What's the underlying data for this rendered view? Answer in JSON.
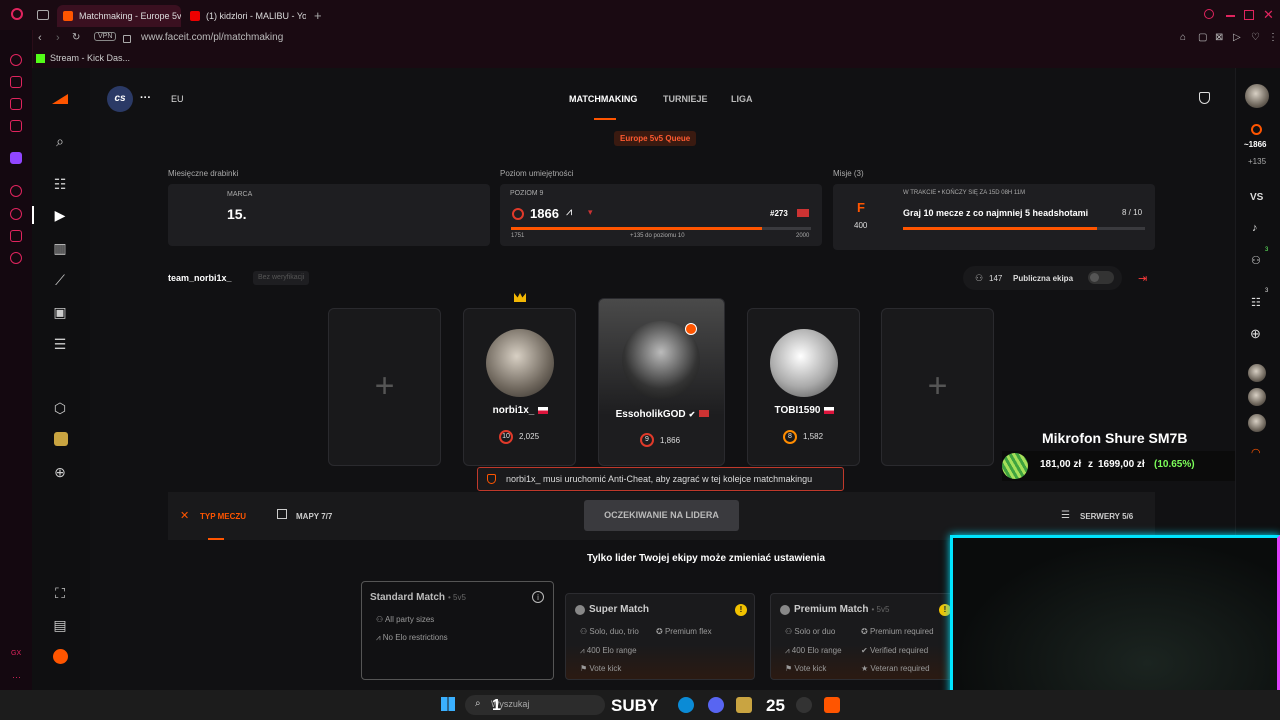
{
  "browser": {
    "tabs": [
      {
        "title": "Matchmaking - Europe 5v5"
      },
      {
        "title": "(1) kidzlori - MALIBU - You"
      }
    ],
    "vpn_badge": "VPN",
    "url": "www.faceit.com/pl/matchmaking",
    "bookmark": "Stream - Kick Das..."
  },
  "header": {
    "game_badge": "cs",
    "region": "EU",
    "nav": [
      "MATCHMAKING",
      "TURNIEJE",
      "LIGA"
    ],
    "active_nav": "MATCHMAKING",
    "queue_badge": "Europe 5v5 Queue"
  },
  "stats": {
    "monthly": {
      "label": "Miesięczne drabinki",
      "month": "MARCA",
      "value": "15."
    },
    "skill": {
      "label": "Poziom umiejętności",
      "level_label": "POZIOM 9",
      "elo": "1866",
      "rank": "#273",
      "progress": 0.836,
      "min": "1751",
      "to_next": "+135 do poziomu 10",
      "max": "2000"
    },
    "missions": {
      "label": "Misje (3)",
      "status": "W TRAKCIE • KOŃCZY SIĘ ZA 15D 08H 11M",
      "grade": "F",
      "points": "400",
      "task": "Graj 10 mecze z co najmniej 5 headshotami",
      "count": "8 / 10",
      "progress": 0.8
    }
  },
  "team": {
    "name": "team_norbi1x_",
    "verify_badge": "Bez weryfikacji",
    "followers": "147",
    "public_label": "Publiczna ekipa"
  },
  "players": [
    {
      "name": "norbi1x_",
      "level": "10",
      "elo": "2,025"
    },
    {
      "name": "EssoholikGOD",
      "level": "9",
      "elo": "1,866"
    },
    {
      "name": "TOBI1590",
      "level": "8",
      "elo": "1,582"
    }
  ],
  "warning": "norbi1x_ musi uruchomić Anti-Cheat, aby zagrać w tej kolejce matchmakingu",
  "match_bar": {
    "type_tab": "TYP MECZU",
    "maps_tab": "MAPY 7/7",
    "waiting_button": "OCZEKIWANIE NA LIDERA",
    "servers_tab": "SERWERY 5/6",
    "leader_note": "Tylko lider Twojej ekipy może zmieniać ustawienia"
  },
  "match_types": [
    {
      "title": "Standard Match",
      "mode": "• 5v5",
      "rows": [
        "All party sizes",
        "No Elo restrictions"
      ]
    },
    {
      "title": "Super Match",
      "mode": "",
      "rows": [
        "Solo, duo, trio",
        "Premium flex",
        "400 Elo range",
        "Vote kick"
      ]
    },
    {
      "title": "Premium Match",
      "mode": "• 5v5",
      "rows": [
        "Solo or duo",
        "Premium required",
        "400 Elo range",
        "Verified required",
        "Vote kick",
        "Veteran required"
      ]
    }
  ],
  "right_sidebar": {
    "elo": "~1866",
    "delta": "+135",
    "vs": "VS",
    "badge_a": "3",
    "badge_b": "3"
  },
  "overlay": {
    "product": "Mikrofon Shure SM7B",
    "price_now": "181,00 zł",
    "price_from_word": "z",
    "price_old": "1699,00 zł",
    "discount": "(10.65%)"
  },
  "taskbar": {
    "search_placeholder": "Wyszukaj",
    "subs": "SUBY",
    "count": "25",
    "sub_one": "1"
  },
  "colors": {
    "accent": "#ff5500",
    "brand_red": "#e0245e",
    "cam_border": "#00e5ff",
    "discount": "#7dff5a"
  }
}
